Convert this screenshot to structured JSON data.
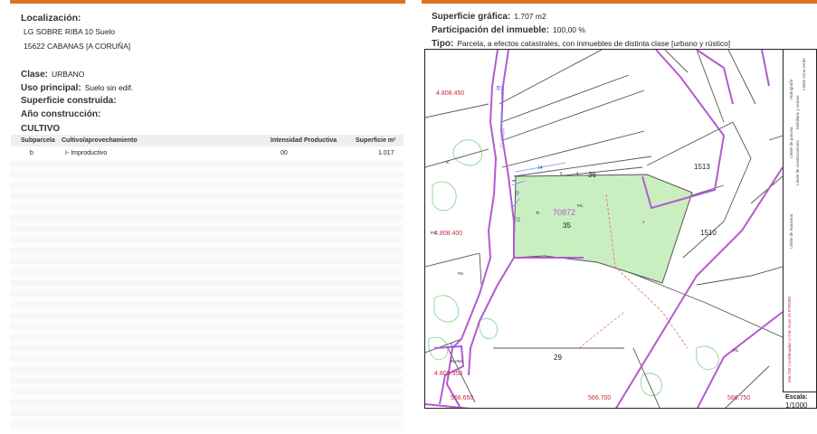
{
  "left": {
    "localizacion_label": "Localización:",
    "address_line1": "LG SOBRE RIBA 10 Suelo",
    "address_line2": "15622 CABANAS [A CORUÑA]",
    "clase_label": "Clase:",
    "clase_value": "URBANO",
    "uso_label": "Uso principal:",
    "uso_value": "Suelo sin edif.",
    "superficie_construida_label": "Superficie construida:",
    "anio_label": "Año construcción:",
    "cultivo_title": "CULTIVO",
    "cultivo_headers": {
      "subparcela": "Subparcela",
      "cultivo": "Cultivo/aprovechamiento",
      "intensidad": "Intensidad Productiva",
      "superficie": "Superficie m²"
    },
    "cultivo_rows": [
      {
        "subparcela": "b",
        "cultivo": "I- Improductivo",
        "intensidad": "00",
        "superficie": "1.017"
      }
    ]
  },
  "right": {
    "superficie_label": "Superficie gráfica:",
    "superficie_value": "1.707 m2",
    "participacion_label": "Participación del inmueble:",
    "participacion_value": "100,00 %",
    "tipo_label": "Tipo:",
    "tipo_value": "Parcela, a efectos catastrales, con inmuebles de distinta clase [urbano y rústico]"
  },
  "map": {
    "parcel_ref": "70872",
    "parcel_numbers": [
      "36",
      "35",
      "1513",
      "1510",
      "29"
    ],
    "coords_y": [
      "4.808.450",
      "4.808.400",
      "4.808.350"
    ],
    "coords_x": [
      "566.650",
      "566.700",
      "566.750"
    ],
    "street_label": "CL SOBR",
    "small_labels": [
      "Tc",
      "Tc",
      "Pd.",
      "Pd.",
      "Pd.",
      "Pd.",
      "RUINA",
      "a"
    ],
    "road_numbers": [
      "18",
      "14",
      "10",
      "12",
      "6"
    ],
    "legend_items": [
      "Límite de parcela",
      "Límite de construcciones",
      "Mobiliario y aceras",
      "Límite zona verde",
      "Hidrografía",
      "Límite de manzana"
    ],
    "coord_system": "566.750 Coordenadas U.T.M. Huso 29 ETRS89",
    "scale_label": "Escala:",
    "scale_value": "1/1000",
    "colors": {
      "parcel_fill": "#c9efc1",
      "boundary": "#b25bd0",
      "accent": "#e2731d",
      "coord_red": "#c03040"
    }
  }
}
